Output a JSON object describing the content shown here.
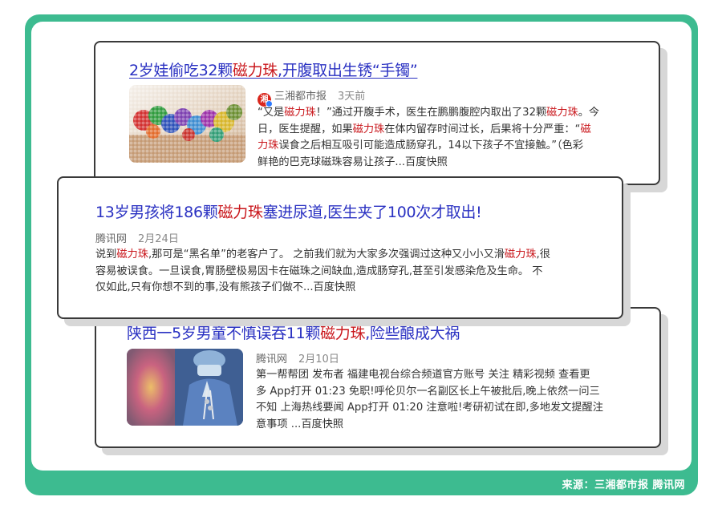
{
  "source_label": "来源：三湘都市报  腾讯网",
  "articles": [
    {
      "title_before": "2岁娃偷吃32颗",
      "title_keyword": "磁力珠",
      "title_after": ",开腹取出生锈“手镯”",
      "publisher": "三湘都市报",
      "time": "3天前",
      "body_lines": [
        [
          "“又是",
          "磁力珠",
          "！”通过开腹手术，医生在鹏鹏腹腔内取出了32颗",
          "磁力珠",
          "。今"
        ],
        [
          "日，医生提醒，如果",
          "磁力珠",
          "在体内留存时间过长，后果将十分严重：“",
          "磁",
          ""
        ],
        [
          "",
          "力珠",
          "误食之后相互吸引可能造成肠穿孔，14以下孩子不宜接触。”（色彩",
          "",
          ""
        ],
        [
          "鲜艳的巴克球磁珠容易让孩子...百度快照",
          "",
          "",
          "",
          ""
        ]
      ],
      "thumbnail": "magnetic-balls-photo"
    },
    {
      "title_before": "13岁男孩将186颗",
      "title_keyword": "磁力珠",
      "title_after": "塞进尿道,医生夹了100次才取出!",
      "publisher": "腾讯网",
      "time": "2月24日",
      "body_lines": [
        [
          "说到",
          "磁力珠",
          ",那可是“黑名单”的老客户了。 之前我们就为大家多次强调过这种又小小又滑",
          "磁力珠",
          ",很"
        ],
        [
          "容易被误食。一旦误食,胃肠壁极易因卡在磁珠之间缺血,造成肠穿孔,甚至引发感染危及生命。 不",
          "",
          "",
          "",
          ""
        ],
        [
          "仅如此,只有你想不到的事,没有熊孩子们做不...百度快照",
          "",
          "",
          "",
          ""
        ]
      ]
    },
    {
      "title_before": "陕西一5岁男童不慎误吞11颗",
      "title_keyword": "磁力珠",
      "title_after": ",险些酿成大祸",
      "publisher": "腾讯网",
      "time": "2月10日",
      "body_lines": [
        [
          "第一帮帮团 发布者 福建电视台综合频道官方账号 关注 精彩视频 查看更",
          "",
          "",
          "",
          ""
        ],
        [
          "多 App打开 01:23 免职!呼伦贝尔一名副区长上午被批后,晚上依然一问三",
          "",
          "",
          "",
          ""
        ],
        [
          "不知 上海热线要闻 App打开 01:20 注意啦!考研初试在即,多地发文提醒注",
          "",
          "",
          "",
          ""
        ],
        [
          "意事项 ...百度快照",
          "",
          "",
          "",
          ""
        ]
      ],
      "thumbnail": "surgery-doctor-photo"
    }
  ],
  "colors": {
    "frame_green": "#3dbb90",
    "title_blue": "#2a31c2",
    "keyword_red": "#c9161b"
  }
}
